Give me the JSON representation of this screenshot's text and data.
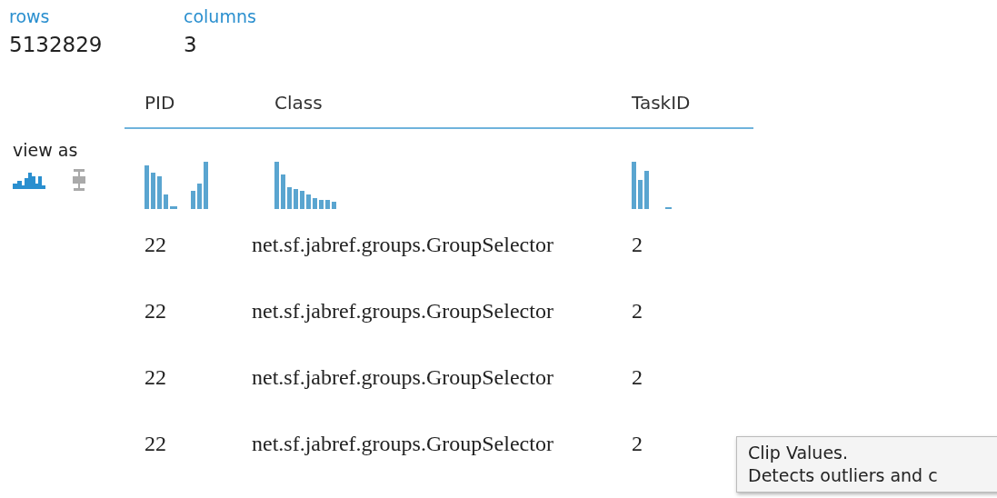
{
  "summary": [
    {
      "label": "rows",
      "value": "5132829"
    },
    {
      "label": "columns",
      "value": "3"
    }
  ],
  "view_as": {
    "label": "view as",
    "modes": [
      {
        "kind": "histogram",
        "selected": true
      },
      {
        "kind": "boxplot",
        "selected": false
      }
    ]
  },
  "table": {
    "columns": [
      "PID",
      "Class",
      "TaskID"
    ],
    "rows": [
      [
        "22",
        "net.sf.jabref.groups.GroupSelector",
        "2"
      ],
      [
        "22",
        "net.sf.jabref.groups.GroupSelector",
        "2"
      ],
      [
        "22",
        "net.sf.jabref.groups.GroupSelector",
        "2"
      ],
      [
        "22",
        "net.sf.jabref.groups.GroupSelector",
        "2"
      ]
    ]
  },
  "tooltip": {
    "title": "Clip Values.",
    "text": "Detects outliers and c"
  }
}
